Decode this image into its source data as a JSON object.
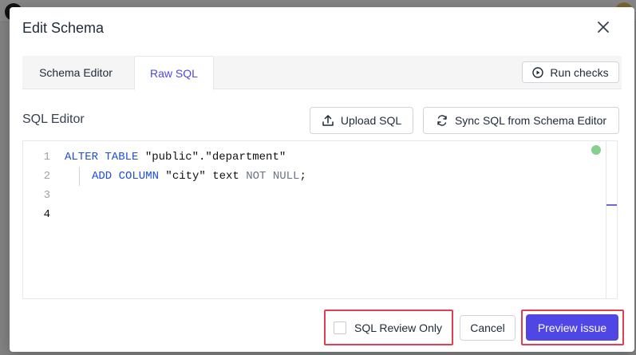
{
  "dialog": {
    "title": "Edit Schema",
    "close_icon": "close-icon"
  },
  "tabs": [
    {
      "label": "Schema Editor",
      "active": false
    },
    {
      "label": "Raw SQL",
      "active": true
    }
  ],
  "toolbar": {
    "run_checks_label": "Run checks",
    "run_checks_icon": "play-circle-icon"
  },
  "sql_editor": {
    "label": "SQL Editor",
    "upload_label": "Upload SQL",
    "upload_icon": "upload-icon",
    "sync_label": "Sync SQL from Schema Editor",
    "sync_icon": "sync-icon",
    "line_numbers": [
      "1",
      "2",
      "3",
      "4"
    ],
    "lines": [
      {
        "kw1": "ALTER TABLE",
        "rest": " \"public\".\"department\""
      },
      {
        "kw1": "ADD COLUMN",
        "mid": " \"city\" text ",
        "kw2": "NOT NULL",
        "end": ";"
      },
      {
        "text": ""
      },
      {
        "text": ""
      }
    ],
    "status_color": "#86d08f"
  },
  "footer": {
    "sql_review_only_label": "SQL Review Only",
    "sql_review_only_checked": false,
    "cancel_label": "Cancel",
    "preview_label": "Preview issue"
  },
  "colors": {
    "accent": "#4f46e5",
    "highlight": "#e03e52",
    "keyword": "#1d4ed8"
  }
}
